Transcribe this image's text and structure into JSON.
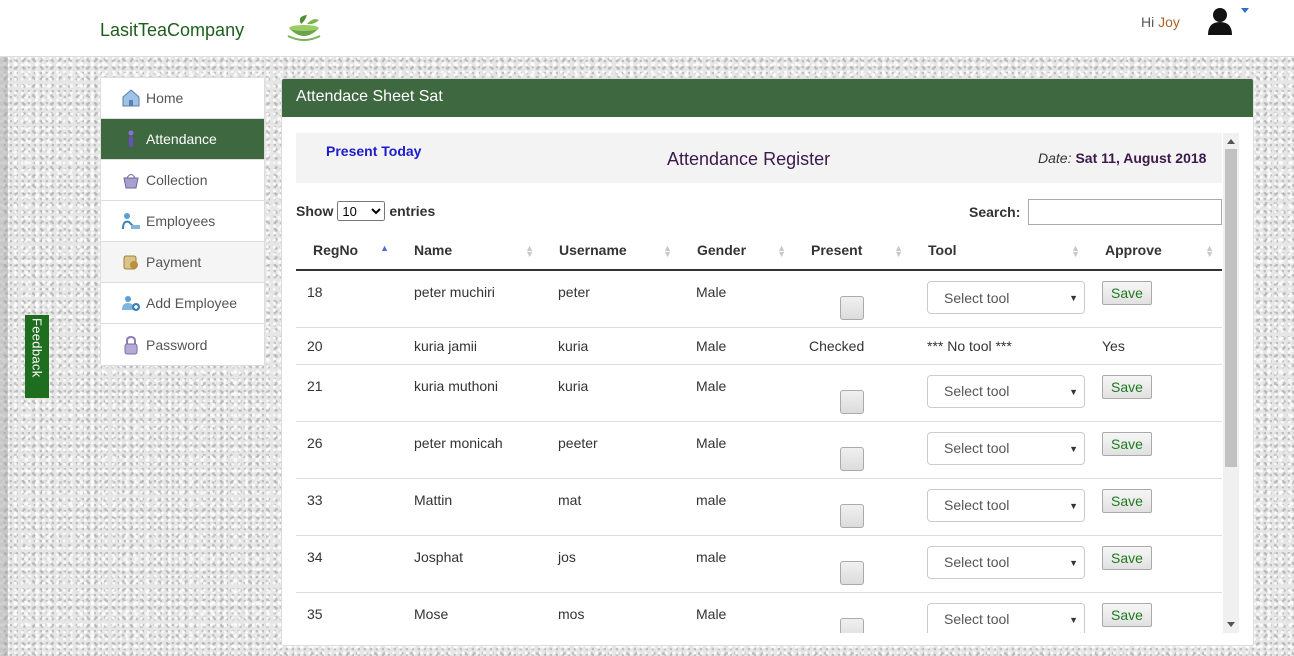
{
  "nav": {
    "brand": "LasitTeaCompany",
    "greeting": "Hi",
    "username": "Joy"
  },
  "sidebar": {
    "items": [
      {
        "label": "Home",
        "icon": "home-icon"
      },
      {
        "label": "Attendance",
        "icon": "attendance-icon"
      },
      {
        "label": "Collection",
        "icon": "basket-icon"
      },
      {
        "label": "Employees",
        "icon": "employees-icon"
      },
      {
        "label": "Payment",
        "icon": "payment-icon"
      },
      {
        "label": "Add Employee",
        "icon": "add-user-icon"
      },
      {
        "label": "Password",
        "icon": "lock-icon"
      }
    ]
  },
  "feedback": {
    "label": "Feedback"
  },
  "panel": {
    "title": "Attendace Sheet Sat",
    "present_today": "Present Today",
    "register_title": "Attendance Register",
    "date_label": "Date:",
    "date_value": "Sat 11, August 2018"
  },
  "table_controls": {
    "show": "Show",
    "entries_value": "10",
    "entries": "entries",
    "search_label": "Search:"
  },
  "table": {
    "headers": [
      "RegNo",
      "Name",
      "Username",
      "Gender",
      "Present",
      "Tool",
      "Approve"
    ],
    "rows": [
      {
        "regno": "18",
        "name": "peter muchiri",
        "username": "peter",
        "gender": "Male",
        "tool": "Select tool",
        "action": "Save"
      },
      {
        "regno": "20",
        "name": "kuria jamii",
        "username": "kuria",
        "gender": "Male",
        "present": "Checked",
        "tool": "*** No tool ***",
        "action": "Yes"
      },
      {
        "regno": "21",
        "name": "kuria muthoni",
        "username": "kuria",
        "gender": "Male",
        "tool": "Select tool",
        "action": "Save"
      },
      {
        "regno": "26",
        "name": "peter monicah",
        "username": "peeter",
        "gender": "Male",
        "tool": "Select tool",
        "action": "Save"
      },
      {
        "regno": "33",
        "name": "Mattin",
        "username": "mat",
        "gender": "male",
        "tool": "Select tool",
        "action": "Save"
      },
      {
        "regno": "34",
        "name": "Josphat",
        "username": "jos",
        "gender": "male",
        "tool": "Select tool",
        "action": "Save"
      },
      {
        "regno": "35",
        "name": "Mose",
        "username": "mos",
        "gender": "Male",
        "tool": "Select tool",
        "action": "Save"
      }
    ]
  },
  "colors": {
    "accent_green": "#3e6840",
    "link_blue": "#1c1ccc",
    "checked_green": "#2a8a2a"
  }
}
